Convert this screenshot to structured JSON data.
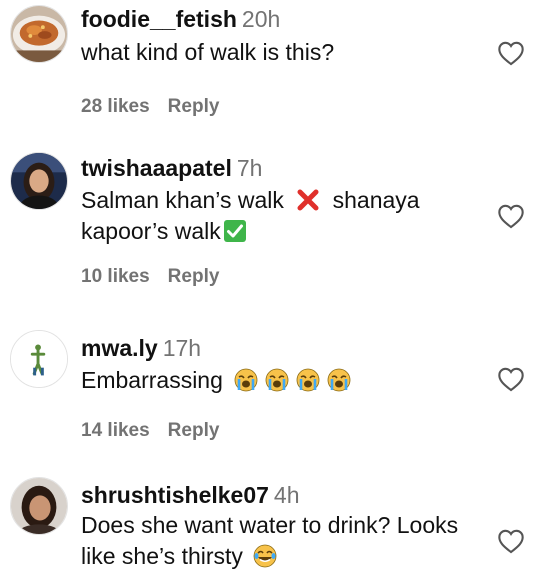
{
  "comments": [
    {
      "username": "foodie__fetish",
      "time": "20h",
      "text": "what kind of walk is this?",
      "likes": "28 likes",
      "reply": "Reply",
      "avatar_icon": "food-plate-photo"
    },
    {
      "username": "twishaaapatel",
      "time": "7h",
      "text_part1": "Salman khan’s walk",
      "text_part2": "shanaya",
      "text_line2": "kapoor’s walk",
      "likes": "10 likes",
      "reply": "Reply",
      "avatar_icon": "woman-portrait-photo",
      "emojis": [
        "cross-mark-emoji",
        "check-mark-button-emoji"
      ]
    },
    {
      "username": "mwa.ly",
      "time": "17h",
      "text": "Embarrassing",
      "likes": "14 likes",
      "reply": "Reply",
      "avatar_icon": "figure-illustration",
      "emojis": [
        "loudly-crying-face-emoji",
        "loudly-crying-face-emoji",
        "loudly-crying-face-emoji",
        "loudly-crying-face-emoji"
      ]
    },
    {
      "username": "shrushtishelke07",
      "time": "4h",
      "text_line1": "Does she want water to drink? Looks",
      "text_line2": "like she’s thirsty",
      "avatar_icon": "woman-portrait-photo",
      "emojis": [
        "face-with-tears-of-joy-emoji"
      ]
    }
  ],
  "colors": {
    "text": "#111111",
    "secondary": "#737373",
    "cross": "#e0302b",
    "check": "#3fb54a",
    "emoji_yellow": "#f7c24a"
  }
}
